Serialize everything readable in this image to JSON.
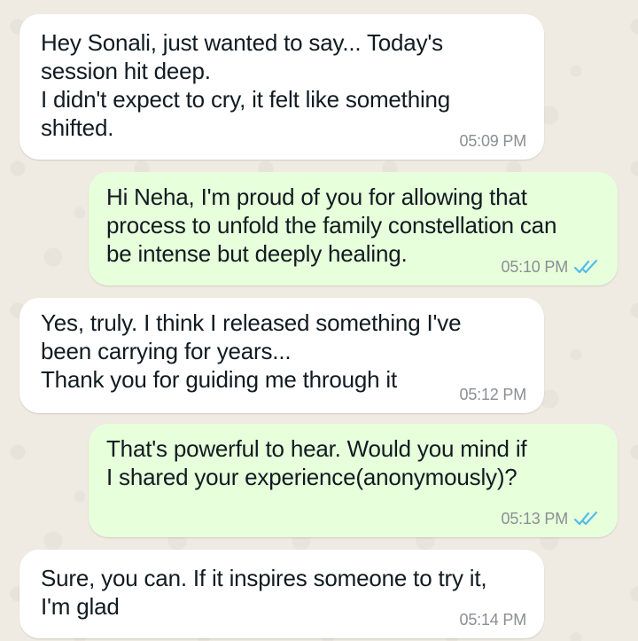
{
  "theme": {
    "incoming_bubble": "#ffffff",
    "outgoing_bubble": "#e7ffdb",
    "read_ticks": "#53bdeb",
    "wallpaper": "#efeae2"
  },
  "messages": [
    {
      "direction": "incoming",
      "text": "Hey Sonali, just wanted to say... Today's\nsession hit deep.\nI didn't expect to cry, it felt like something\nshifted.",
      "time": "05:09 PM"
    },
    {
      "direction": "outgoing",
      "text": "Hi Neha, I'm proud of you for allowing that\nprocess to unfold the family constellation can\nbe intense but deeply healing.",
      "time": "05:10 PM",
      "status": "read-double-check-icon"
    },
    {
      "direction": "incoming",
      "text": "Yes, truly. I think I released something I've\nbeen carrying for years...\nThank you for guiding me through it",
      "time": "05:12 PM"
    },
    {
      "direction": "outgoing",
      "text": "That's powerful to hear. Would you mind if\nI shared your experience(anonymously)?",
      "time": "05:13 PM",
      "status": "read-double-check-icon"
    },
    {
      "direction": "incoming",
      "text": "Sure, you can. If it inspires someone to try it,\nI'm glad",
      "time": "05:14 PM"
    }
  ]
}
